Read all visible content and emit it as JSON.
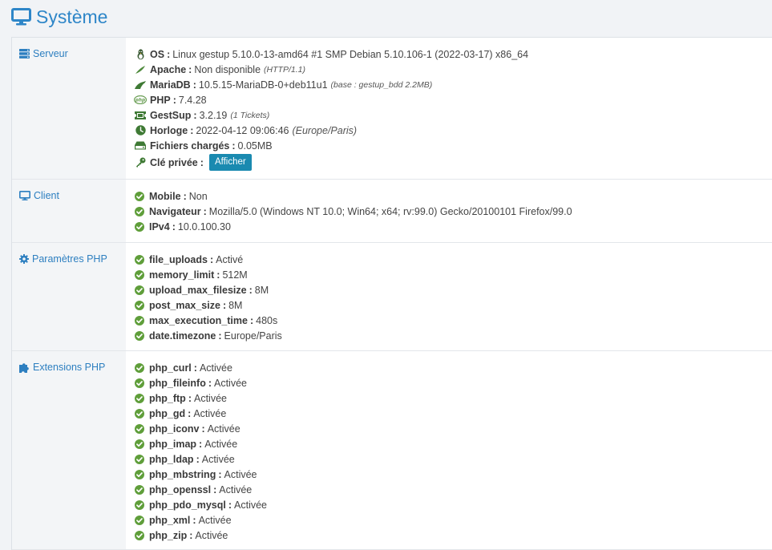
{
  "page": {
    "title": "Système"
  },
  "sections": {
    "serveur": {
      "label": "Serveur",
      "os": {
        "key": "OS",
        "value": "Linux gestup 5.10.0-13-amd64 #1 SMP Debian 5.10.106-1 (2022-03-17) x86_64"
      },
      "apache": {
        "key": "Apache",
        "value": "Non disponible",
        "note": "(HTTP/1.1)"
      },
      "mariadb": {
        "key": "MariaDB",
        "value": "10.5.15-MariaDB-0+deb11u1",
        "note": "(base : gestup_bdd 2.2MB)"
      },
      "php": {
        "key": "PHP",
        "value": "7.4.28"
      },
      "gestsup": {
        "key": "GestSup",
        "value": "3.2.19",
        "note": "(1 Tickets)"
      },
      "horloge": {
        "key": "Horloge",
        "value": "2022-04-12 09:06:46",
        "note": "(Europe/Paris)"
      },
      "fichiers": {
        "key": "Fichiers chargés",
        "value": "0.05MB"
      },
      "cle": {
        "key": "Clé privée",
        "button": "Afficher"
      }
    },
    "client": {
      "label": "Client",
      "items": [
        {
          "key": "Mobile",
          "value": "Non"
        },
        {
          "key": "Navigateur",
          "value": "Mozilla/5.0 (Windows NT 10.0; Win64; x64; rv:99.0) Gecko/20100101 Firefox/99.0"
        },
        {
          "key": "IPv4",
          "value": "10.0.100.30"
        }
      ]
    },
    "params": {
      "label": "Paramètres PHP",
      "items": [
        {
          "key": "file_uploads",
          "value": "Activé"
        },
        {
          "key": "memory_limit",
          "value": "512M"
        },
        {
          "key": "upload_max_filesize",
          "value": "8M"
        },
        {
          "key": "post_max_size",
          "value": "8M"
        },
        {
          "key": "max_execution_time",
          "value": "480s"
        },
        {
          "key": "date.timezone",
          "value": "Europe/Paris"
        }
      ]
    },
    "extensions": {
      "label": "Extensions PHP",
      "items": [
        {
          "key": "php_curl",
          "value": "Activée"
        },
        {
          "key": "php_fileinfo",
          "value": "Activée"
        },
        {
          "key": "php_ftp",
          "value": "Activée"
        },
        {
          "key": "php_gd",
          "value": "Activée"
        },
        {
          "key": "php_iconv",
          "value": "Activée"
        },
        {
          "key": "php_imap",
          "value": "Activée"
        },
        {
          "key": "php_ldap",
          "value": "Activée"
        },
        {
          "key": "php_mbstring",
          "value": "Activée"
        },
        {
          "key": "php_openssl",
          "value": "Activée"
        },
        {
          "key": "php_pdo_mysql",
          "value": "Activée"
        },
        {
          "key": "php_xml",
          "value": "Activée"
        },
        {
          "key": "php_zip",
          "value": "Activée"
        }
      ]
    }
  },
  "icons": {
    "title": "desktop-icon",
    "serveur": "server-icon",
    "client": "desktop-icon",
    "params": "gear-icon",
    "extensions": "puzzle-icon",
    "check": "check-circle-icon",
    "os": "linux-icon",
    "apache": "feather-icon",
    "mariadb": "seal-icon",
    "php": "php-icon",
    "gestsup": "ticket-icon",
    "horloge": "clock-icon",
    "fichiers": "hdd-icon",
    "cle": "key-icon"
  },
  "colors": {
    "accent": "#2e86c8",
    "success": "#5f9e3a",
    "button": "#1a8ab0"
  }
}
